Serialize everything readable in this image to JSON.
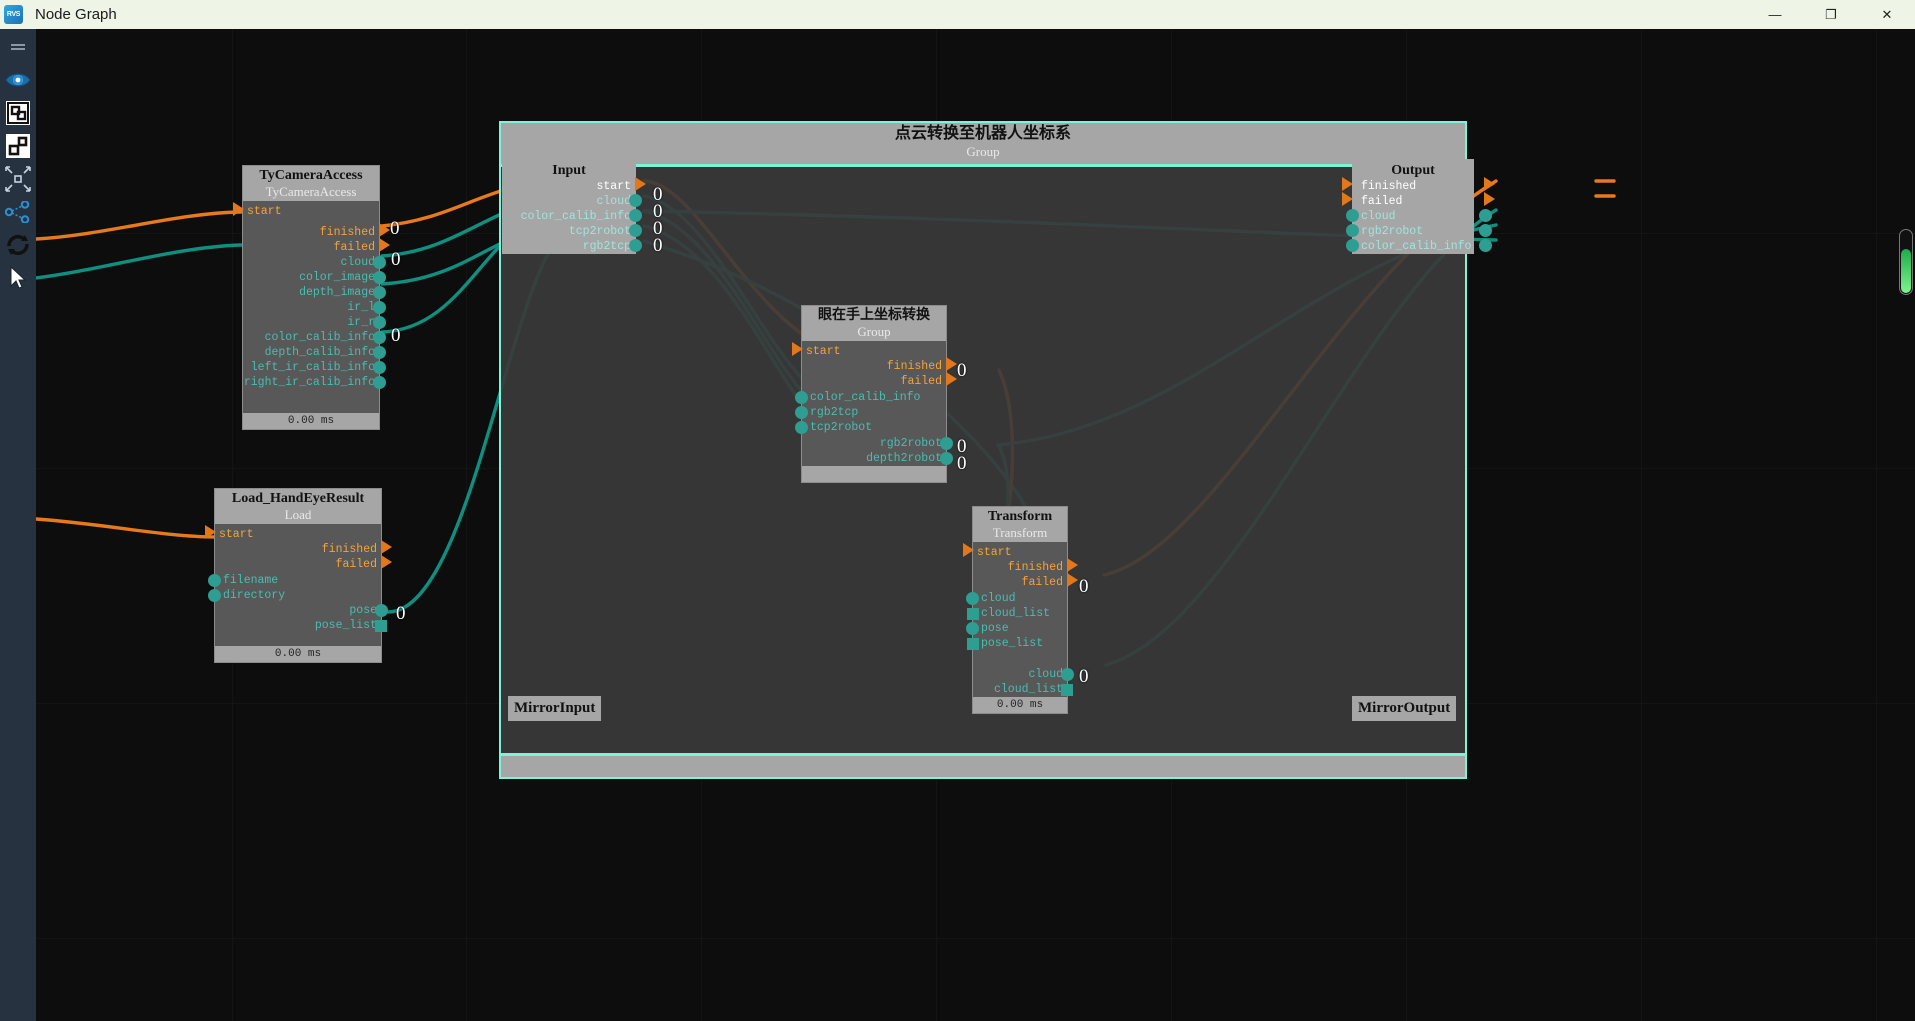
{
  "window": {
    "app_logo_text": "RVS",
    "title": "Node Graph",
    "controls": {
      "minimize": "—",
      "maximize": "❐",
      "close": "✕"
    }
  },
  "toolbar": {
    "items": [
      {
        "name": "menu-handle-icon",
        "label": "menu"
      },
      {
        "name": "eye-icon",
        "label": "visibility"
      },
      {
        "name": "group-node-icon",
        "label": "group"
      },
      {
        "name": "ungroup-node-icon",
        "label": "ungroup"
      },
      {
        "name": "collapse-icon",
        "label": "collapse"
      },
      {
        "name": "share-graph-icon",
        "label": "graph"
      },
      {
        "name": "refresh-icon",
        "label": "refresh"
      },
      {
        "name": "cursor-icon",
        "label": "select"
      }
    ]
  },
  "nodes": [
    {
      "id": "tycameraaccess",
      "title": "TyCameraAccess",
      "subtitle": "TyCameraAccess",
      "footer": "0.00 ms",
      "inputs": [
        {
          "label": "start",
          "kind": "exec"
        }
      ],
      "outputs": [
        {
          "label": "finished",
          "kind": "exec",
          "badge": "0"
        },
        {
          "label": "failed",
          "kind": "exec"
        },
        {
          "label": "cloud",
          "kind": "data",
          "badge": "0"
        },
        {
          "label": "color_image",
          "kind": "data"
        },
        {
          "label": "depth_image",
          "kind": "data"
        },
        {
          "label": "ir_l",
          "kind": "data"
        },
        {
          "label": "ir_r",
          "kind": "data"
        },
        {
          "label": "color_calib_info",
          "kind": "data",
          "badge": "0"
        },
        {
          "label": "depth_calib_info",
          "kind": "data"
        },
        {
          "label": "left_ir_calib_info",
          "kind": "data"
        },
        {
          "label": "right_ir_calib_info",
          "kind": "data"
        }
      ]
    },
    {
      "id": "load_handeyeresult",
      "title": "Load_HandEyeResult",
      "subtitle": "Load",
      "footer": "0.00 ms",
      "inputs": [
        {
          "label": "start",
          "kind": "exec"
        },
        {
          "label": "filename",
          "kind": "data"
        },
        {
          "label": "directory",
          "kind": "data"
        }
      ],
      "outputs": [
        {
          "label": "finished",
          "kind": "exec"
        },
        {
          "label": "failed",
          "kind": "exec"
        },
        {
          "label": "pose",
          "kind": "data",
          "badge": "0"
        },
        {
          "label": "pose_list",
          "kind": "data-list"
        }
      ]
    },
    {
      "id": "input-node",
      "title": "Input",
      "ports": [
        {
          "label": "start",
          "kind": "exec"
        },
        {
          "label": "cloud",
          "kind": "data",
          "badge": "0"
        },
        {
          "label": "color_calib_info",
          "kind": "data",
          "badge": "0"
        },
        {
          "label": "tcp2robot",
          "kind": "data",
          "badge": "0"
        },
        {
          "label": "rgb2tcp",
          "kind": "data",
          "badge": "0"
        }
      ]
    },
    {
      "id": "handeye-group",
      "title": "眼在手上坐标转换",
      "subtitle": "Group",
      "inputs": [
        {
          "label": "start",
          "kind": "exec"
        },
        {
          "label": "color_calib_info",
          "kind": "data"
        },
        {
          "label": "rgb2tcp",
          "kind": "data"
        },
        {
          "label": "tcp2robot",
          "kind": "data"
        }
      ],
      "outputs": [
        {
          "label": "finished",
          "kind": "exec",
          "badge": "0"
        },
        {
          "label": "failed",
          "kind": "exec"
        },
        {
          "label": "rgb2robot",
          "kind": "data",
          "badge": "0"
        },
        {
          "label": "depth2robot",
          "kind": "data",
          "badge": "0"
        }
      ]
    },
    {
      "id": "transform",
      "title": "Transform",
      "subtitle": "Transform",
      "footer": "0.00 ms",
      "inputs": [
        {
          "label": "start",
          "kind": "exec"
        },
        {
          "label": "cloud",
          "kind": "data"
        },
        {
          "label": "cloud_list",
          "kind": "data-list"
        },
        {
          "label": "pose",
          "kind": "data"
        },
        {
          "label": "pose_list",
          "kind": "data-list"
        }
      ],
      "outputs": [
        {
          "label": "finished",
          "kind": "exec",
          "badge": "0"
        },
        {
          "label": "failed",
          "kind": "exec"
        },
        {
          "label": "cloud",
          "kind": "data",
          "badge": "0"
        },
        {
          "label": "cloud_list",
          "kind": "data-list"
        }
      ]
    },
    {
      "id": "output-node",
      "title": "Output",
      "ports": [
        {
          "label": "finished",
          "kind": "exec"
        },
        {
          "label": "failed",
          "kind": "exec"
        },
        {
          "label": "cloud",
          "kind": "data"
        },
        {
          "label": "rgb2robot",
          "kind": "data"
        },
        {
          "label": "color_calib_info",
          "kind": "data"
        }
      ]
    }
  ],
  "group": {
    "title": "点云转换至机器人坐标系",
    "subtitle": "Group",
    "mirror_input_label": "MirrorInput",
    "mirror_output_label": "MirrorOutput"
  },
  "colors": {
    "exec": "#f4a33a",
    "data": "#49bdb0",
    "wire_exec": "#e8791c",
    "wire_data": "#0f8f80",
    "group_border": "#7ff3d6",
    "node_header": "#a6a6a6",
    "node_body": "#585858",
    "canvas": "#0d0d0d",
    "titlebar": "#eef5e6",
    "toolbar": "#273240",
    "slider": "#2fbf55"
  }
}
